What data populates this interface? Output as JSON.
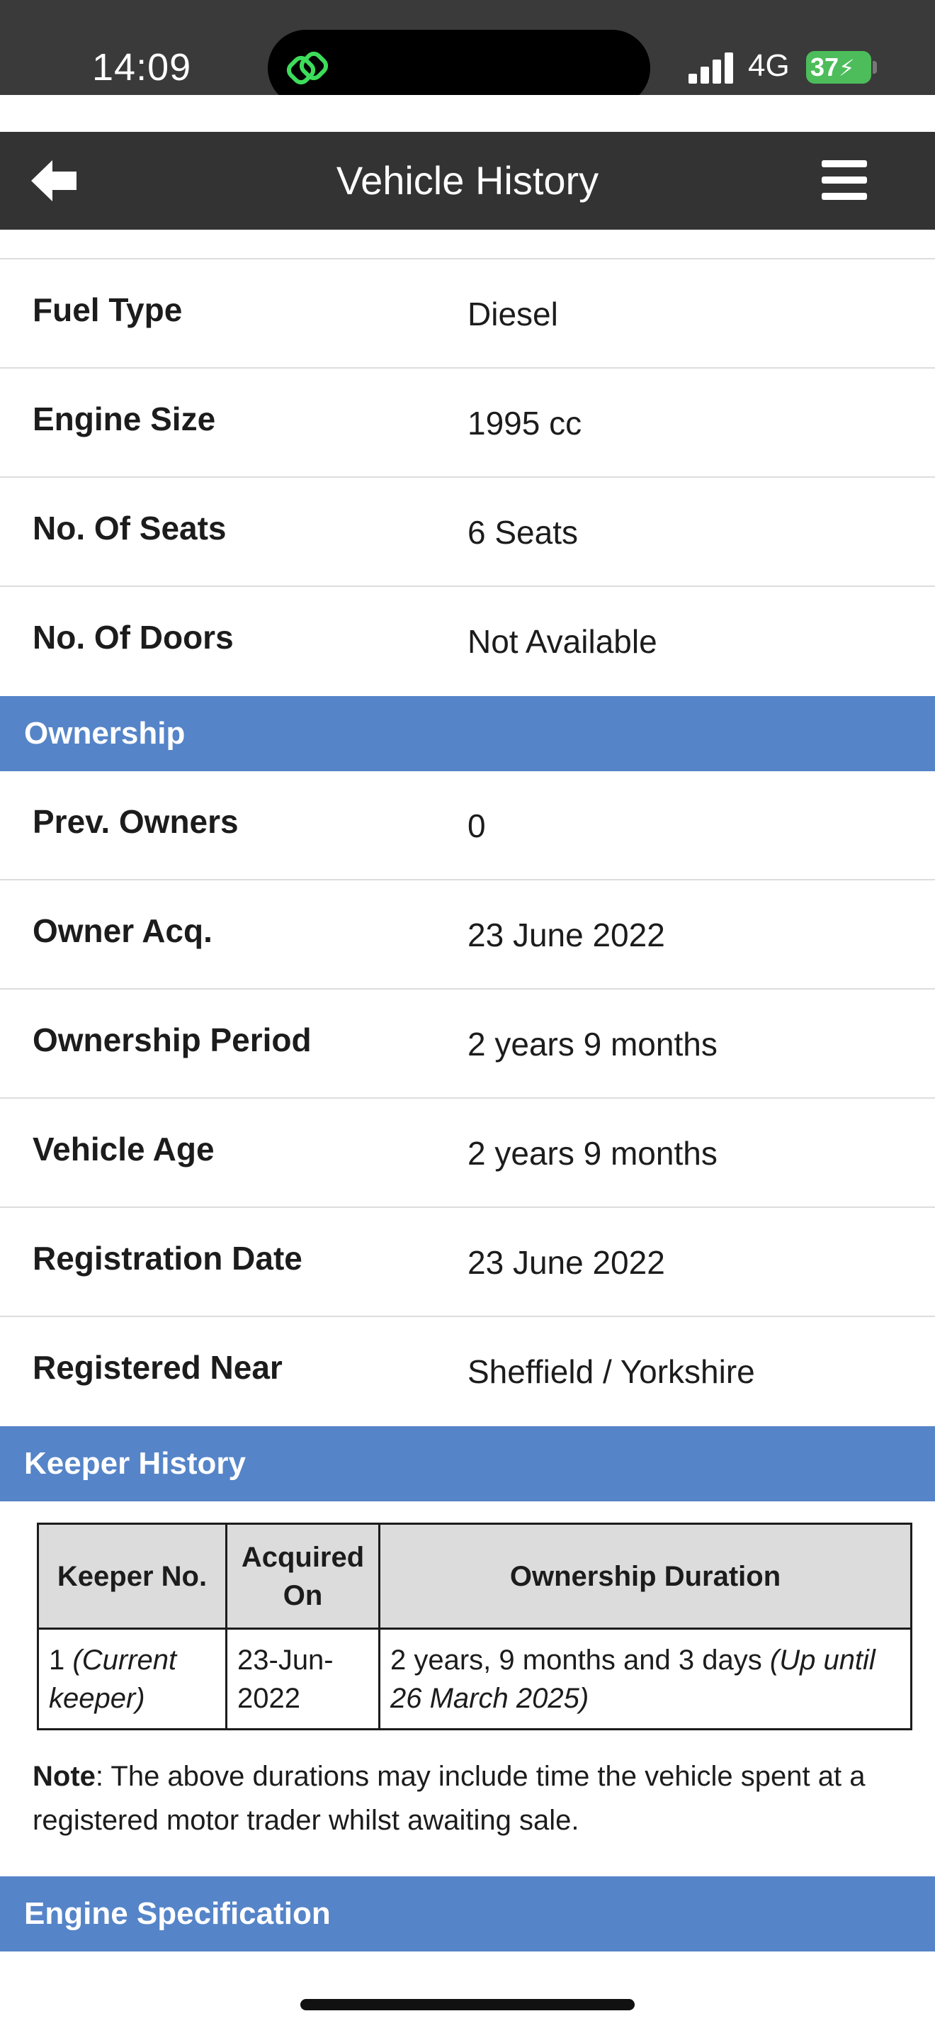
{
  "status": {
    "time": "14:09",
    "network": "4G",
    "battery": "37"
  },
  "header": {
    "title": "Vehicle History"
  },
  "spec_rows": [
    {
      "label": "Fuel Type",
      "value": "Diesel"
    },
    {
      "label": "Engine Size",
      "value": "1995 cc"
    },
    {
      "label": "No. Of Seats",
      "value": "6 Seats"
    },
    {
      "label": "No. Of Doors",
      "value": "Not Available"
    }
  ],
  "ownership": {
    "heading": "Ownership",
    "rows": [
      {
        "label": "Prev. Owners",
        "value": "0"
      },
      {
        "label": "Owner Acq.",
        "value": "23 June 2022"
      },
      {
        "label": "Ownership Period",
        "value": "2 years 9 months"
      },
      {
        "label": "Vehicle Age",
        "value": "2 years 9 months"
      },
      {
        "label": "Registration Date",
        "value": "23 June 2022"
      },
      {
        "label": "Registered Near",
        "value": "Sheffield / Yorkshire"
      }
    ]
  },
  "keeper_history": {
    "heading": "Keeper History",
    "columns": [
      "Keeper No.",
      "Acquired On",
      "Ownership Duration"
    ],
    "rows": [
      {
        "keeper_no": "1",
        "keeper_note": "(Current keeper)",
        "acquired_on": "23-Jun-2022",
        "duration": "2 years, 9 months and 3 days",
        "duration_note": "(Up until 26 March 2025)"
      }
    ],
    "note_label": "Note",
    "note_text": ": The above durations may include time the vehicle spent at a registered motor trader whilst awaiting sale."
  },
  "engine": {
    "heading": "Engine Specification"
  },
  "colors": {
    "section_header": "#5584c8",
    "nav_bar": "#333333",
    "battery": "#4cbd5a",
    "app_icon": "#3ddc5a"
  }
}
